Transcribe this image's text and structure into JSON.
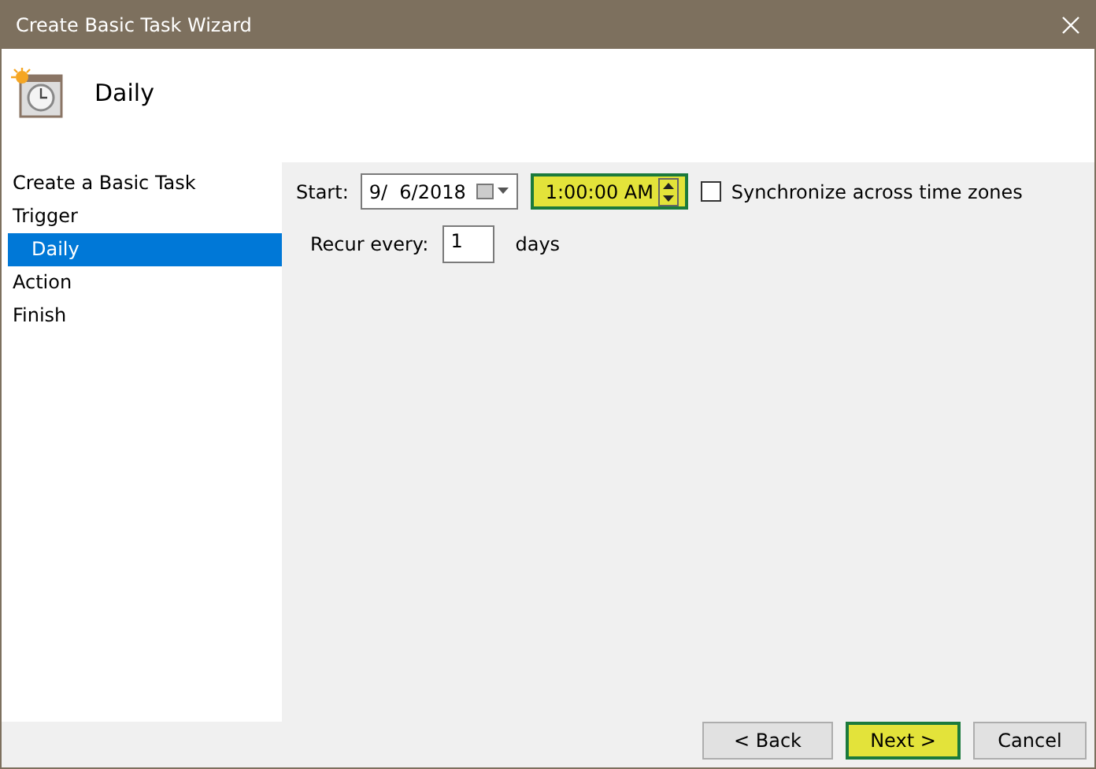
{
  "window": {
    "title": "Create Basic Task Wizard"
  },
  "header": {
    "title": "Daily"
  },
  "steps": [
    {
      "label": "Create a Basic Task",
      "selected": false
    },
    {
      "label": "Trigger",
      "selected": false,
      "children": [
        {
          "label": "Daily",
          "selected": true
        }
      ]
    },
    {
      "label": "Action",
      "selected": false
    },
    {
      "label": "Finish",
      "selected": false
    }
  ],
  "start": {
    "label": "Start:",
    "date": "9/  6/2018",
    "time": "1:00:00 AM",
    "time_highlighted": true
  },
  "sync": {
    "label": "Synchronize across time zones",
    "checked": false
  },
  "recur": {
    "label": "Recur every:",
    "value": "1",
    "unit": "days"
  },
  "buttons": [
    {
      "label": "< Back",
      "highlighted": false
    },
    {
      "label": "Next >",
      "highlighted": true
    },
    {
      "label": "Cancel",
      "highlighted": false
    }
  ]
}
